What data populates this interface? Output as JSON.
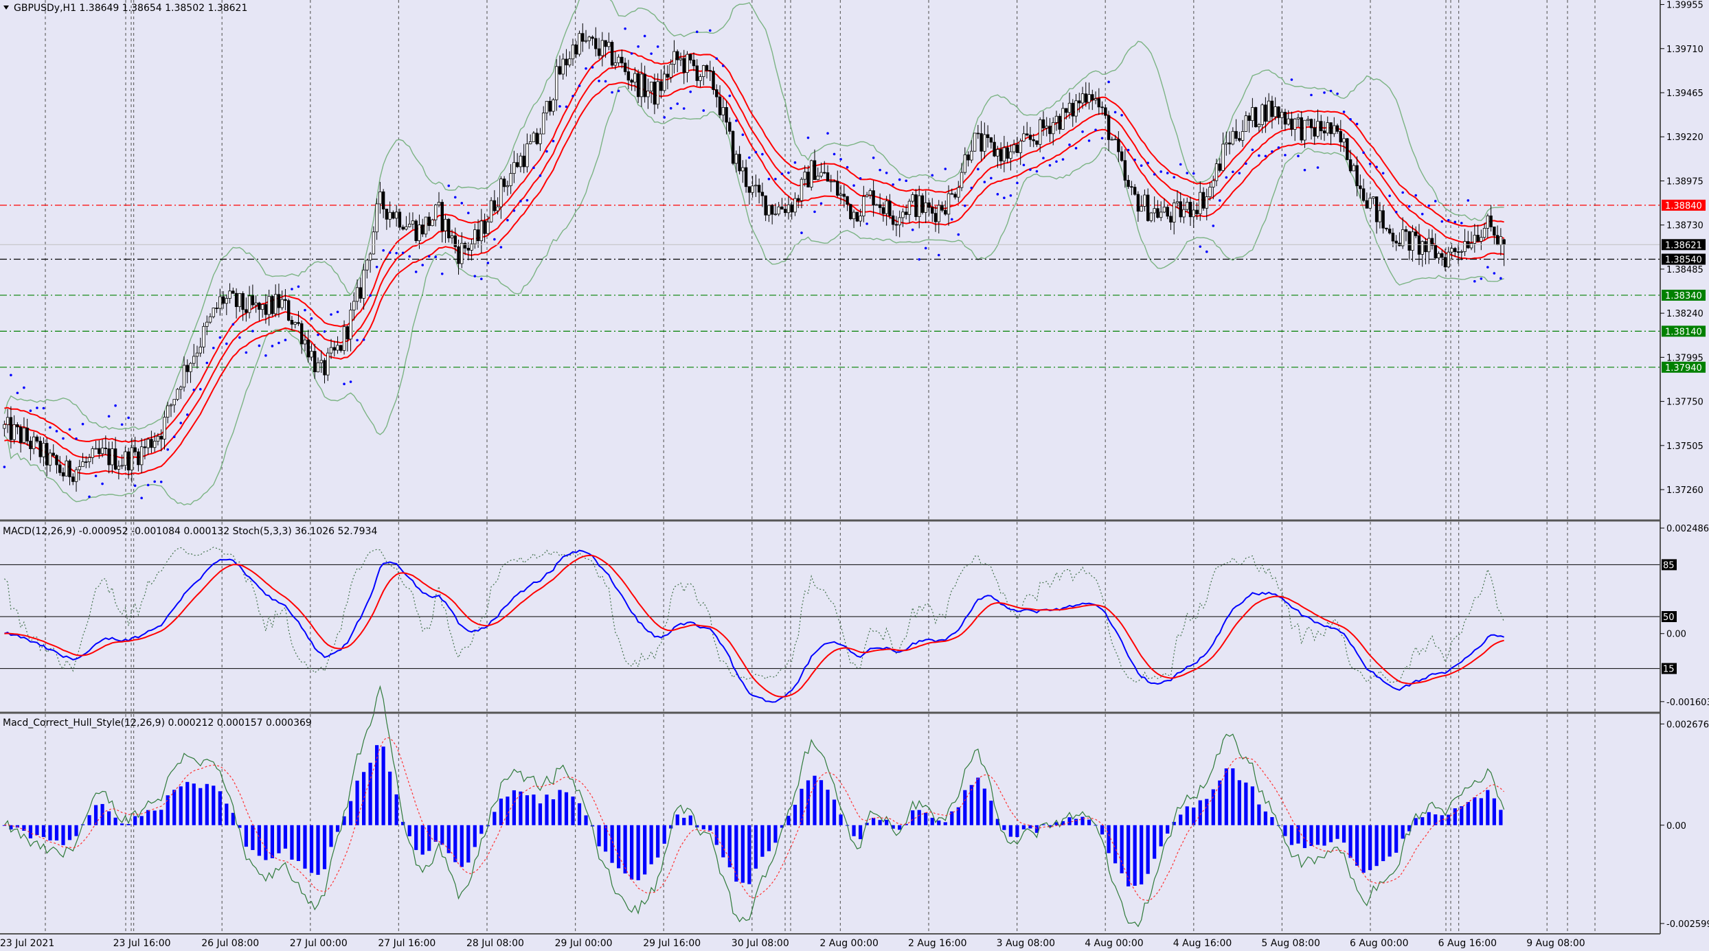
{
  "window": {
    "symbol_header": "GBPUSDy,H1  1.38649 1.38654 1.38502 1.38621"
  },
  "chart_data": [
    {
      "type": "candlestick",
      "title": "GBPUSDy,H1  1.38649 1.38654 1.38502 1.38621",
      "ylim": [
        1.371,
        1.3998
      ],
      "y_ticks": [
        "1.39955",
        "1.39710",
        "1.39465",
        "1.39220",
        "1.38975",
        "1.38730",
        "1.38485",
        "1.38240",
        "1.37995",
        "1.37750",
        "1.37505",
        "1.37260"
      ],
      "x_labels": [
        "23 Jul 2021",
        "23 Jul 16:00",
        "26 Jul 08:00",
        "27 Jul 00:00",
        "27 Jul 16:00",
        "28 Jul 08:00",
        "29 Jul 00:00",
        "29 Jul 16:00",
        "30 Jul 08:00",
        "2 Aug 00:00",
        "2 Aug 16:00",
        "3 Aug 08:00",
        "4 Aug 00:00",
        "4 Aug 16:00",
        "5 Aug 08:00",
        "6 Aug 00:00",
        "6 Aug 16:00",
        "9 Aug 08:00"
      ],
      "close_path": [
        1.376,
        1.3755,
        1.3745,
        1.3735,
        1.374,
        1.3745,
        1.3742,
        1.3748,
        1.376,
        1.379,
        1.381,
        1.3832,
        1.3828,
        1.3825,
        1.383,
        1.3815,
        1.379,
        1.3805,
        1.3835,
        1.3885,
        1.3878,
        1.387,
        1.388,
        1.3858,
        1.3865,
        1.389,
        1.3908,
        1.392,
        1.3955,
        1.3975,
        1.3972,
        1.3965,
        1.3952,
        1.3945,
        1.3965,
        1.396,
        1.395,
        1.391,
        1.389,
        1.3882,
        1.3885,
        1.3905,
        1.3895,
        1.388,
        1.389,
        1.3878,
        1.3885,
        1.388,
        1.3888,
        1.392,
        1.3915,
        1.3912,
        1.392,
        1.393,
        1.3935,
        1.395,
        1.3925,
        1.389,
        1.3882,
        1.3878,
        1.3882,
        1.389,
        1.392,
        1.393,
        1.3938,
        1.3933,
        1.3925,
        1.3927,
        1.3915,
        1.389,
        1.387,
        1.3865,
        1.386,
        1.3855,
        1.3864,
        1.3873,
        1.3862
      ],
      "bollinger": {
        "period": 20,
        "color": "#7bb383"
      },
      "envelope_lines_color": "#ff0000",
      "parabolic_sar_color": "#0000ff",
      "horizontal_levels": [
        {
          "value": "1.38840",
          "style": "red-dash",
          "color": "#ff0000"
        },
        {
          "value": "1.38540",
          "style": "black-dash",
          "color": "#000000"
        },
        {
          "value": "1.38340",
          "style": "green-dash",
          "color": "#008000"
        },
        {
          "value": "1.38140",
          "style": "green-dash",
          "color": "#008000"
        },
        {
          "value": "1.37940",
          "style": "green-dash",
          "color": "#008000"
        }
      ],
      "current_price": "1.38621",
      "grid": true
    },
    {
      "type": "line",
      "title": "MACD(12,26,9) -0.000952 -0.001084 0.000132  Stoch(5,3,3) 36.1026 52.7934",
      "ylim": [
        -0.0018,
        0.0026
      ],
      "y_ticks": [
        "0.002486",
        "0.00",
        "-0.001603"
      ],
      "levels": [
        "85",
        "50",
        "15"
      ],
      "series": [
        {
          "name": "MACD(12,26,9)",
          "color": "#0000ff"
        },
        {
          "name": "Signal",
          "color": "#ff0000"
        },
        {
          "name": "Stoch(5,3,3)",
          "color": "#41704a",
          "style": "dotted"
        }
      ]
    },
    {
      "type": "bar",
      "title": "Macd_Correct_Hull_Style(12,26,9) 0.000212 0.000157 0.000369",
      "ylim": [
        -0.0028,
        0.0029
      ],
      "y_ticks": [
        "0.002676",
        "0.00",
        "-0.002599"
      ],
      "series": [
        {
          "name": "Histogram",
          "color": "#0000ff"
        },
        {
          "name": "Line",
          "color": "#2f7a3a"
        },
        {
          "name": "Signal",
          "color": "#ff3333",
          "style": "dotted"
        }
      ]
    }
  ]
}
